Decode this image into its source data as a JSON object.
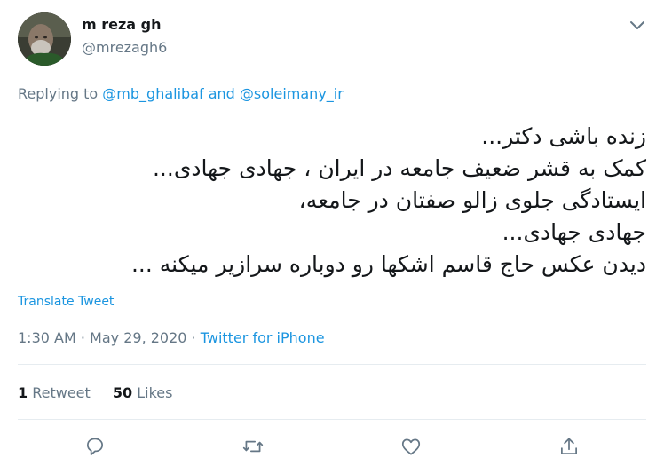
{
  "author": {
    "display_name": "m reza gh",
    "handle": "@mrezagh6",
    "avatar_icon": "user-avatar-photo"
  },
  "reply": {
    "prefix": "Replying to",
    "mentions": [
      "@mb_ghalibaf",
      "@soleimany_ir"
    ],
    "joiner": "and"
  },
  "tweet": {
    "lines": [
      "زنده باشی دکتر...",
      "کمک به قشر ضعیف جامعه در ایران ، جهادی جهادی...",
      "ایستادگی جلوی زالو صفتان در جامعه،",
      "جهادی جهادی...",
      "دیدن عکس حاج قاسم اشکها رو دوباره سرازیر میکنه ..."
    ],
    "translate_label": "Translate Tweet"
  },
  "meta": {
    "time": "1:30 AM",
    "separator": "·",
    "date": "May 29, 2020",
    "source": "Twitter for iPhone"
  },
  "stats": {
    "retweet_count": "1",
    "retweet_label": "Retweet",
    "like_count": "50",
    "like_label": "Likes"
  },
  "actions": [
    "reply-icon",
    "retweet-icon",
    "like-icon",
    "share-icon"
  ],
  "colors": {
    "link": "#1b95e0",
    "secondary_text": "#657786",
    "primary_text": "#14171a",
    "divider": "#e6ecf0"
  }
}
